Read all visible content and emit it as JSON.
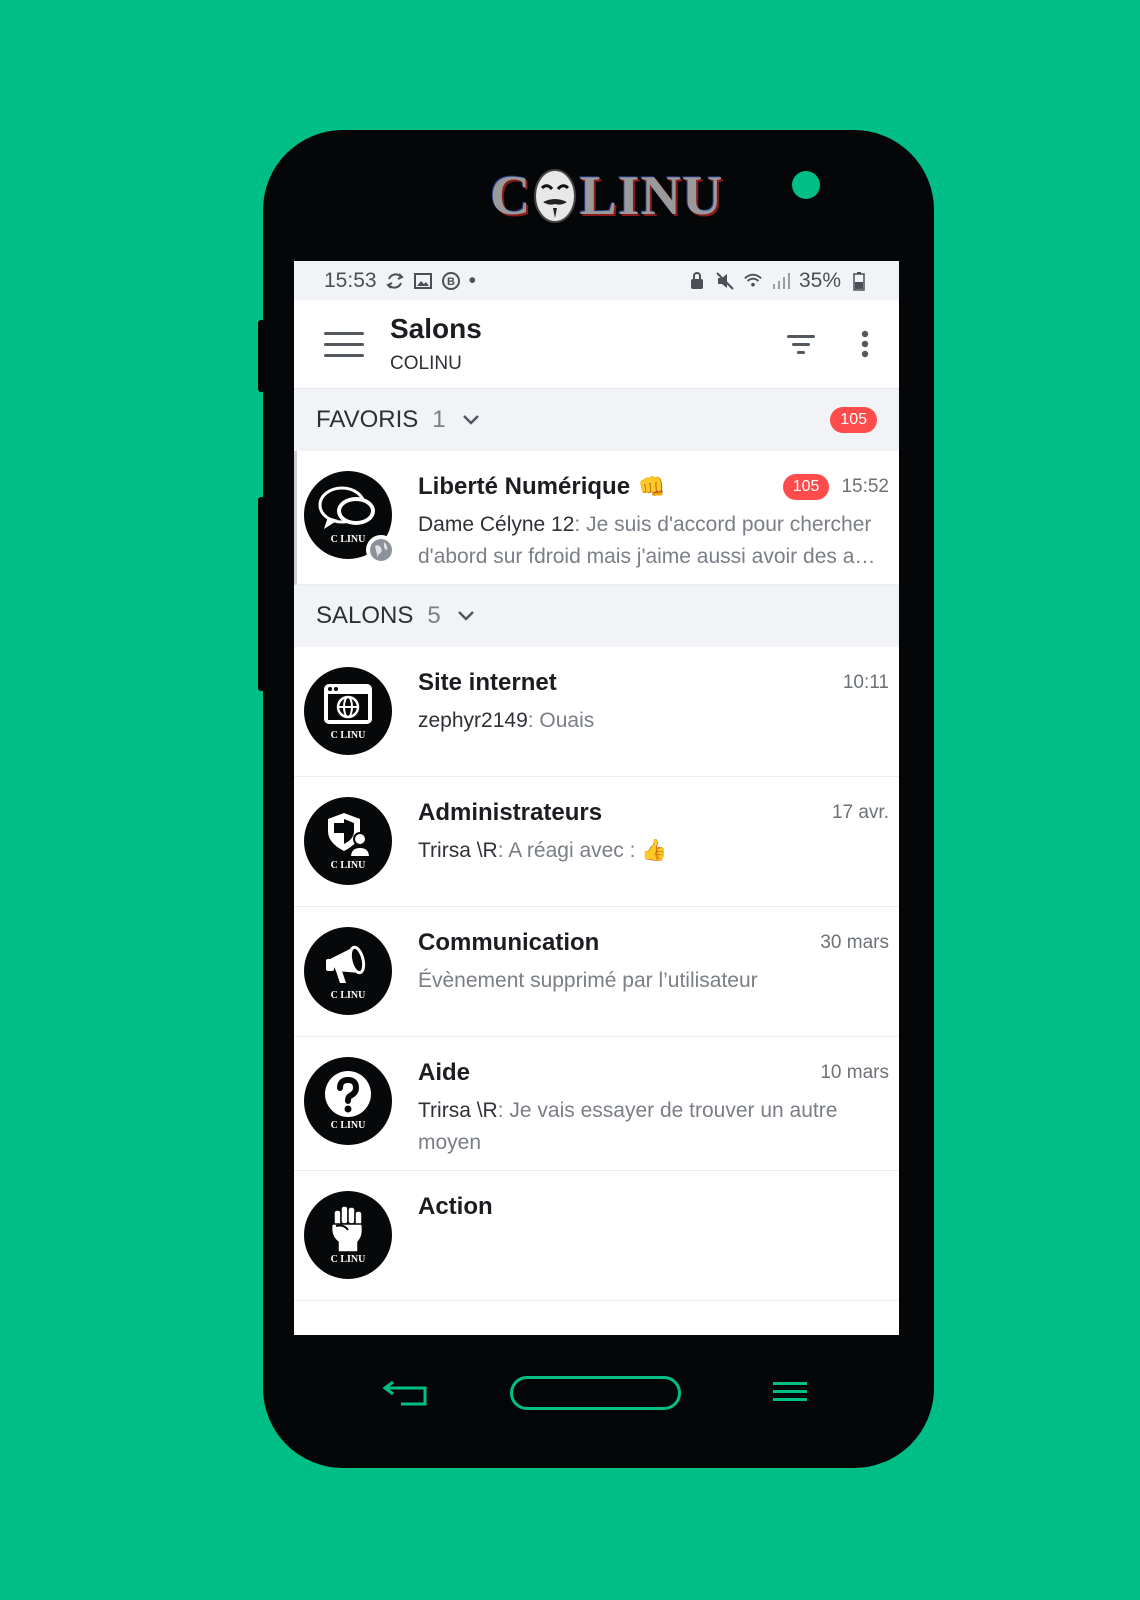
{
  "branding": {
    "logo_left": "C",
    "logo_right": "LINU"
  },
  "status_bar": {
    "time": "15:53",
    "dot": "•",
    "battery": "35%"
  },
  "app_bar": {
    "title": "Salons",
    "subtitle": "COLINU"
  },
  "sections": {
    "favorites": {
      "label": "FAVORIS",
      "count": "1",
      "badge": "105"
    },
    "rooms": {
      "label": "SALONS",
      "count": "5"
    }
  },
  "favorite_room": {
    "name": "Liberté Numérique",
    "emoji": "👊",
    "badge": "105",
    "time": "15:52",
    "sender": "Dame Célyne 12",
    "message": ": Je suis d'accord pour chercher d'abord sur fdroid mais j'aime aussi avoir des a…",
    "avatar_tag": "C LINU"
  },
  "rooms": [
    {
      "name": "Site internet",
      "time": "10:11",
      "sender": "zephyr2149",
      "message": ": Ouais",
      "avatar_tag": "C LINU"
    },
    {
      "name": "Administrateurs",
      "time": "17 avr.",
      "sender": "Trirsa \\R",
      "message": ": A réagi avec : 👍",
      "avatar_tag": "C LINU"
    },
    {
      "name": "Communication",
      "time": "30 mars",
      "sender": "",
      "message": "Évènement supprimé par l’utilisateur",
      "avatar_tag": "C LINU"
    },
    {
      "name": "Aide",
      "time": "10 mars",
      "sender": "Trirsa \\R",
      "message": ": Je vais essayer de trouver un autre moyen",
      "avatar_tag": "C LINU"
    },
    {
      "name": "Action",
      "time": "",
      "sender": "",
      "message": "",
      "avatar_tag": "C LINU"
    }
  ],
  "colors": {
    "background": "#00bf86",
    "badge": "#ff4b4b",
    "phone": "#050608"
  }
}
